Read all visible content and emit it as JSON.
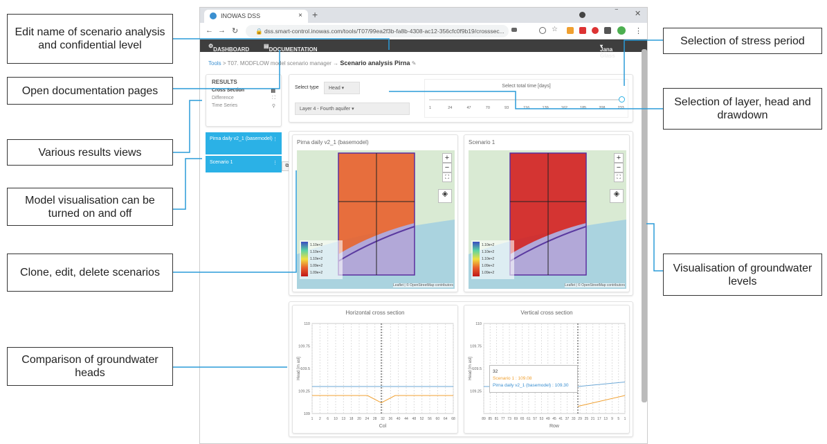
{
  "callouts": {
    "edit_name": "Edit name of scenario analysis and confidential level",
    "open_docs": "Open documentation pages",
    "results_views": "Various results views",
    "model_vis": "Model visualisation can be turned on and off",
    "clone": "Clone, edit, delete scenarios",
    "comparison": "Comparison of groundwater heads",
    "stress_period": "Selection of stress period",
    "layer_sel": "Selection of layer, head and drawdown",
    "vis_gw": "Visualisation of groundwater levels"
  },
  "browser": {
    "tab_title": "INOWAS DSS",
    "tab_close": "×",
    "new_tab": "+",
    "url": "dss.smart-control.inowas.com/tools/T07/99ea2f3b-fa8b-4308-ac12-356cfc0f9b19/crosssec...",
    "minimize": "‾",
    "close": "✕"
  },
  "appnav": {
    "dashboard": "DASHBOARD",
    "documentation": "DOCUMENTATION",
    "user": "Jana Glass"
  },
  "breadcrumb": {
    "tools": "Tools",
    "tool": "T07. MODFLOW model scenario manager",
    "analysis": "Scenario analysis Pirna"
  },
  "results": {
    "title": "RESULTS",
    "items": [
      {
        "label": "Cross Section",
        "icon": "▤"
      },
      {
        "label": "Difference",
        "icon": "⛶"
      },
      {
        "label": "Time Series",
        "icon": "⚲"
      }
    ]
  },
  "scenarios": [
    {
      "label": "Pirna daily v2_1 (basemodel)"
    },
    {
      "label": "Scenario 1"
    }
  ],
  "selectors": {
    "type_label": "Select type",
    "type_value": "Head",
    "layer_value": "Layer 4 - Fourth aquifer",
    "time_title": "Select total time [days]",
    "time_ticks": [
      "1",
      "24",
      "47",
      "70",
      "93",
      "116",
      "139",
      "162",
      "185",
      "208",
      "233"
    ]
  },
  "maps": {
    "left_title": "Pirna daily v2_1 (basemodel)",
    "right_title": "Scenario 1",
    "attribution": "Leaflet | © OpenStreetMap contributors",
    "left_legend": [
      "1.10e+2",
      "1.10e+2",
      "1.10e+2",
      "1.09e+2",
      "1.09e+2"
    ],
    "right_legend": [
      "1.10e+2",
      "1.10e+2",
      "1.10e+2",
      "1.09e+2",
      "1.09e+2"
    ]
  },
  "charts": {
    "left_title": "Horizontal cross section",
    "right_title": "Vertical cross section",
    "left_xlabel": "Col",
    "right_xlabel": "Row",
    "ylabel": "Head [m asl]",
    "left_yticks": [
      "110",
      "109.75",
      "109.5",
      "109.25",
      "109"
    ],
    "right_yticks": [
      "110",
      "109.75",
      "109.5",
      "109.25"
    ],
    "left_xticks": [
      "1",
      "2",
      "6",
      "10",
      "13",
      "18",
      "20",
      "24",
      "28",
      "32",
      "36",
      "40",
      "44",
      "48",
      "52",
      "56",
      "60",
      "64",
      "68"
    ],
    "right_xticks": [
      "89",
      "85",
      "81",
      "77",
      "73",
      "69",
      "65",
      "61",
      "57",
      "53",
      "49",
      "45",
      "41",
      "37",
      "33",
      "29",
      "25",
      "21",
      "17",
      "13",
      "9",
      "5",
      "1"
    ],
    "tooltip_title": "32",
    "tooltip_scenario": "Scenario 1 : 109.08",
    "tooltip_base": "Pirna daily v2_1 (basemodel) : 109.30",
    "colors": {
      "base": "#6ba7d6",
      "scenario": "#f0a030"
    }
  },
  "chart_data": [
    {
      "type": "line",
      "title": "Horizontal cross section",
      "xlabel": "Col",
      "ylabel": "Head [m asl]",
      "ylim": [
        109,
        110
      ],
      "series": [
        {
          "name": "Pirna daily v2_1 (basemodel)",
          "values": [
            109.3,
            109.3,
            109.3
          ]
        },
        {
          "name": "Scenario 1",
          "values": [
            109.2,
            109.12,
            109.2
          ]
        }
      ]
    },
    {
      "type": "line",
      "title": "Vertical cross section",
      "xlabel": "Row",
      "ylabel": "Head [m asl]",
      "ylim": [
        109,
        110
      ],
      "series": [
        {
          "name": "Pirna daily v2_1 (basemodel)",
          "values": [
            109.3,
            109.35
          ]
        },
        {
          "name": "Scenario 1",
          "values": [
            109.08,
            109.2
          ]
        }
      ]
    }
  ]
}
